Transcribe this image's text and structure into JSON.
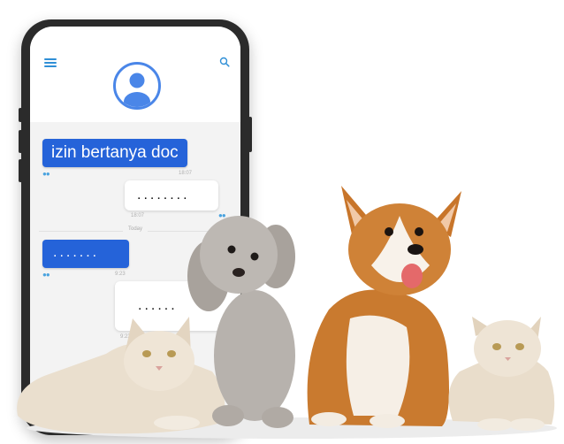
{
  "header": {
    "menu_icon": "hamburger-menu-icon",
    "search_icon": "search-icon",
    "avatar_icon": "user-avatar-icon",
    "accent_color": "#4a86e8"
  },
  "chat": {
    "messages": [
      {
        "direction": "incoming",
        "text": "izin bertanya doc",
        "time": "18:07"
      },
      {
        "direction": "outgoing",
        "text": "........",
        "time": "18:07"
      },
      {
        "direction": "incoming",
        "text": ".......",
        "time": "9:23"
      },
      {
        "direction": "outgoing",
        "text": "......",
        "time": "9:23"
      }
    ],
    "day_divider": "Today",
    "incoming_color": "#2563d9",
    "outgoing_color": "#ffffff"
  }
}
